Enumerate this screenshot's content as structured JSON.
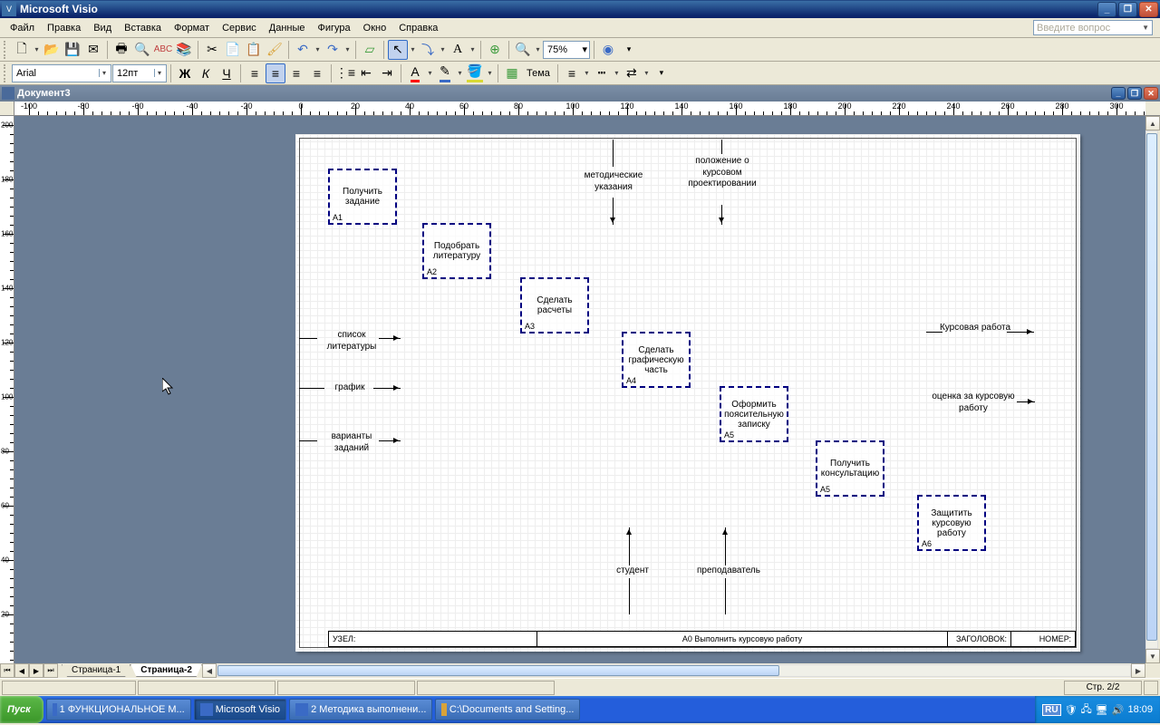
{
  "app": {
    "title": "Microsoft Visio"
  },
  "menus": [
    "Файл",
    "Правка",
    "Вид",
    "Вставка",
    "Формат",
    "Сервис",
    "Данные",
    "Фигура",
    "Окно",
    "Справка"
  ],
  "help_placeholder": "Введите вопрос",
  "toolbar": {
    "zoom": "75%",
    "font": "Arial",
    "size": "12пт",
    "theme_label": "Тема"
  },
  "doc": {
    "title": "Документ3"
  },
  "ruler_h": [
    "-100",
    "-80",
    "-60",
    "-40",
    "-20",
    "0",
    "20",
    "40",
    "60",
    "80",
    "100",
    "120",
    "140",
    "160",
    "180",
    "200",
    "220",
    "240",
    "260",
    "280",
    "300"
  ],
  "ruler_v": [
    "200",
    "180",
    "160",
    "140",
    "120",
    "100",
    "80",
    "60",
    "40",
    "20"
  ],
  "boxes": {
    "a1": {
      "text": "Получить задание",
      "id": "A1"
    },
    "a2": {
      "text": "Подобрать литературу",
      "id": "A2"
    },
    "a3": {
      "text": "Сделать расчеты",
      "id": "A3"
    },
    "a4": {
      "text": "Сделать графическую часть",
      "id": "A4"
    },
    "a5": {
      "text": "Оформить поясительную записку",
      "id": "A5"
    },
    "a5b": {
      "text": "Получить консультацию",
      "id": "A5"
    },
    "a6": {
      "text": "Защитить курсовую работу",
      "id": "A6"
    }
  },
  "labels": {
    "metod": "методические указания",
    "polozh": "положение о курсовом проектировании",
    "spisok": "список литературы",
    "grafik": "график",
    "variant": "варианты заданий",
    "kurs": "Курсовая работа",
    "ocenka": "оценка за курсовую работу",
    "student": "студент",
    "prepod": "преподаватель"
  },
  "info": {
    "node_lbl": "УЗЕЛ:",
    "title_text": "A0 Выполнить курсовую работу",
    "title_lbl": "ЗАГОЛОВОК:",
    "num_lbl": "НОМЕР:"
  },
  "tabs": [
    "Страница-1",
    "Страница-2"
  ],
  "status": {
    "page": "Стр. 2/2"
  },
  "taskbar": {
    "start": "Пуск",
    "tasks": [
      "1 ФУНКЦИОНАЛЬНОЕ М...",
      "Microsoft Visio",
      "2 Методика выполнени...",
      "C:\\Documents and Setting..."
    ],
    "lang": "RU",
    "time": "18:09"
  }
}
